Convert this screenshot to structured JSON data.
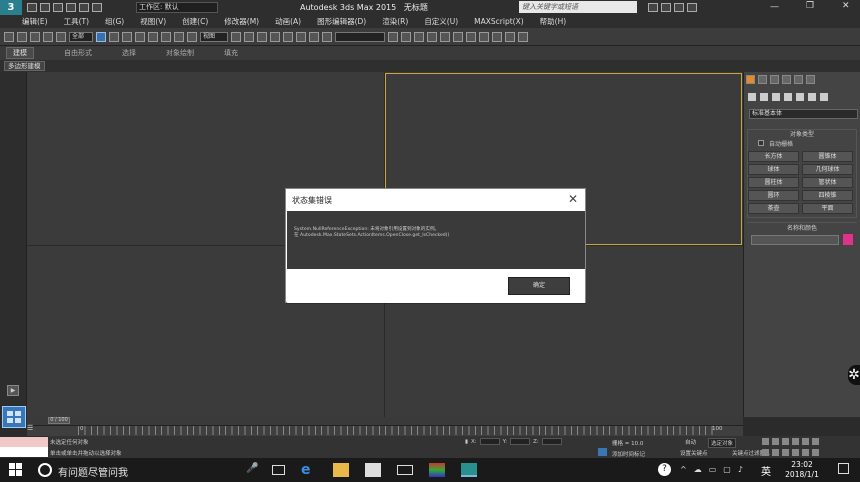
{
  "titlebar": {
    "workspace_label": "工作区: 默认",
    "app_title": "Autodesk 3ds Max 2015",
    "doc_title": "无标题",
    "search_placeholder": "键入关键字或短语"
  },
  "menu": [
    "编辑(E)",
    "工具(T)",
    "组(G)",
    "视图(V)",
    "创建(C)",
    "修改器(M)",
    "动画(A)",
    "图形编辑器(D)",
    "渲染(R)",
    "自定义(U)",
    "MAXScript(X)",
    "帮助(H)"
  ],
  "toolbar": {
    "selection_filter": "全部",
    "view_label": "视图"
  },
  "ribbon": [
    "建模",
    "自由形式",
    "选择",
    "对象绘制",
    "填充"
  ],
  "subtab": "多边形建模",
  "command_panel": {
    "category": "标准基本体",
    "rollout_object_type": "对象类型",
    "autogrid": "自动栅格",
    "buttons": [
      "长方体",
      "圆锥体",
      "球体",
      "几何球体",
      "圆柱体",
      "管状体",
      "圆环",
      "四棱锥",
      "茶壶",
      "平面"
    ],
    "rollout_name_color": "名称和颜色",
    "swatch_color": "#e0328c"
  },
  "timeline": {
    "frame_display": "0 / 100",
    "tick_start": "0",
    "tick_end": "100"
  },
  "status": {
    "line1": "未选定任何对象",
    "line2": "单击或单击并拖动以选择对象",
    "x_label": "X:",
    "y_label": "Y:",
    "z_label": "Z:",
    "grid": "栅格 = 10.0",
    "autokey": "自动",
    "setkey": "设置关键点",
    "selected": "选定对象",
    "keyfilter": "关键点过滤器...",
    "add_time_tag": "添加时间标记"
  },
  "taskbar": {
    "search_text": "有问题尽管问我",
    "ime": "英",
    "time": "23:02",
    "date": "2018/1/1"
  },
  "dialog": {
    "title": "状态集错误",
    "message_line1": "System.NullReferenceException: 未将对象引用设置到对象的实例。",
    "message_line2": "   在 Autodesk.Max.StateSets.ActionItems.OpenClose.get_IsChecked()",
    "ok_label": "确定"
  }
}
